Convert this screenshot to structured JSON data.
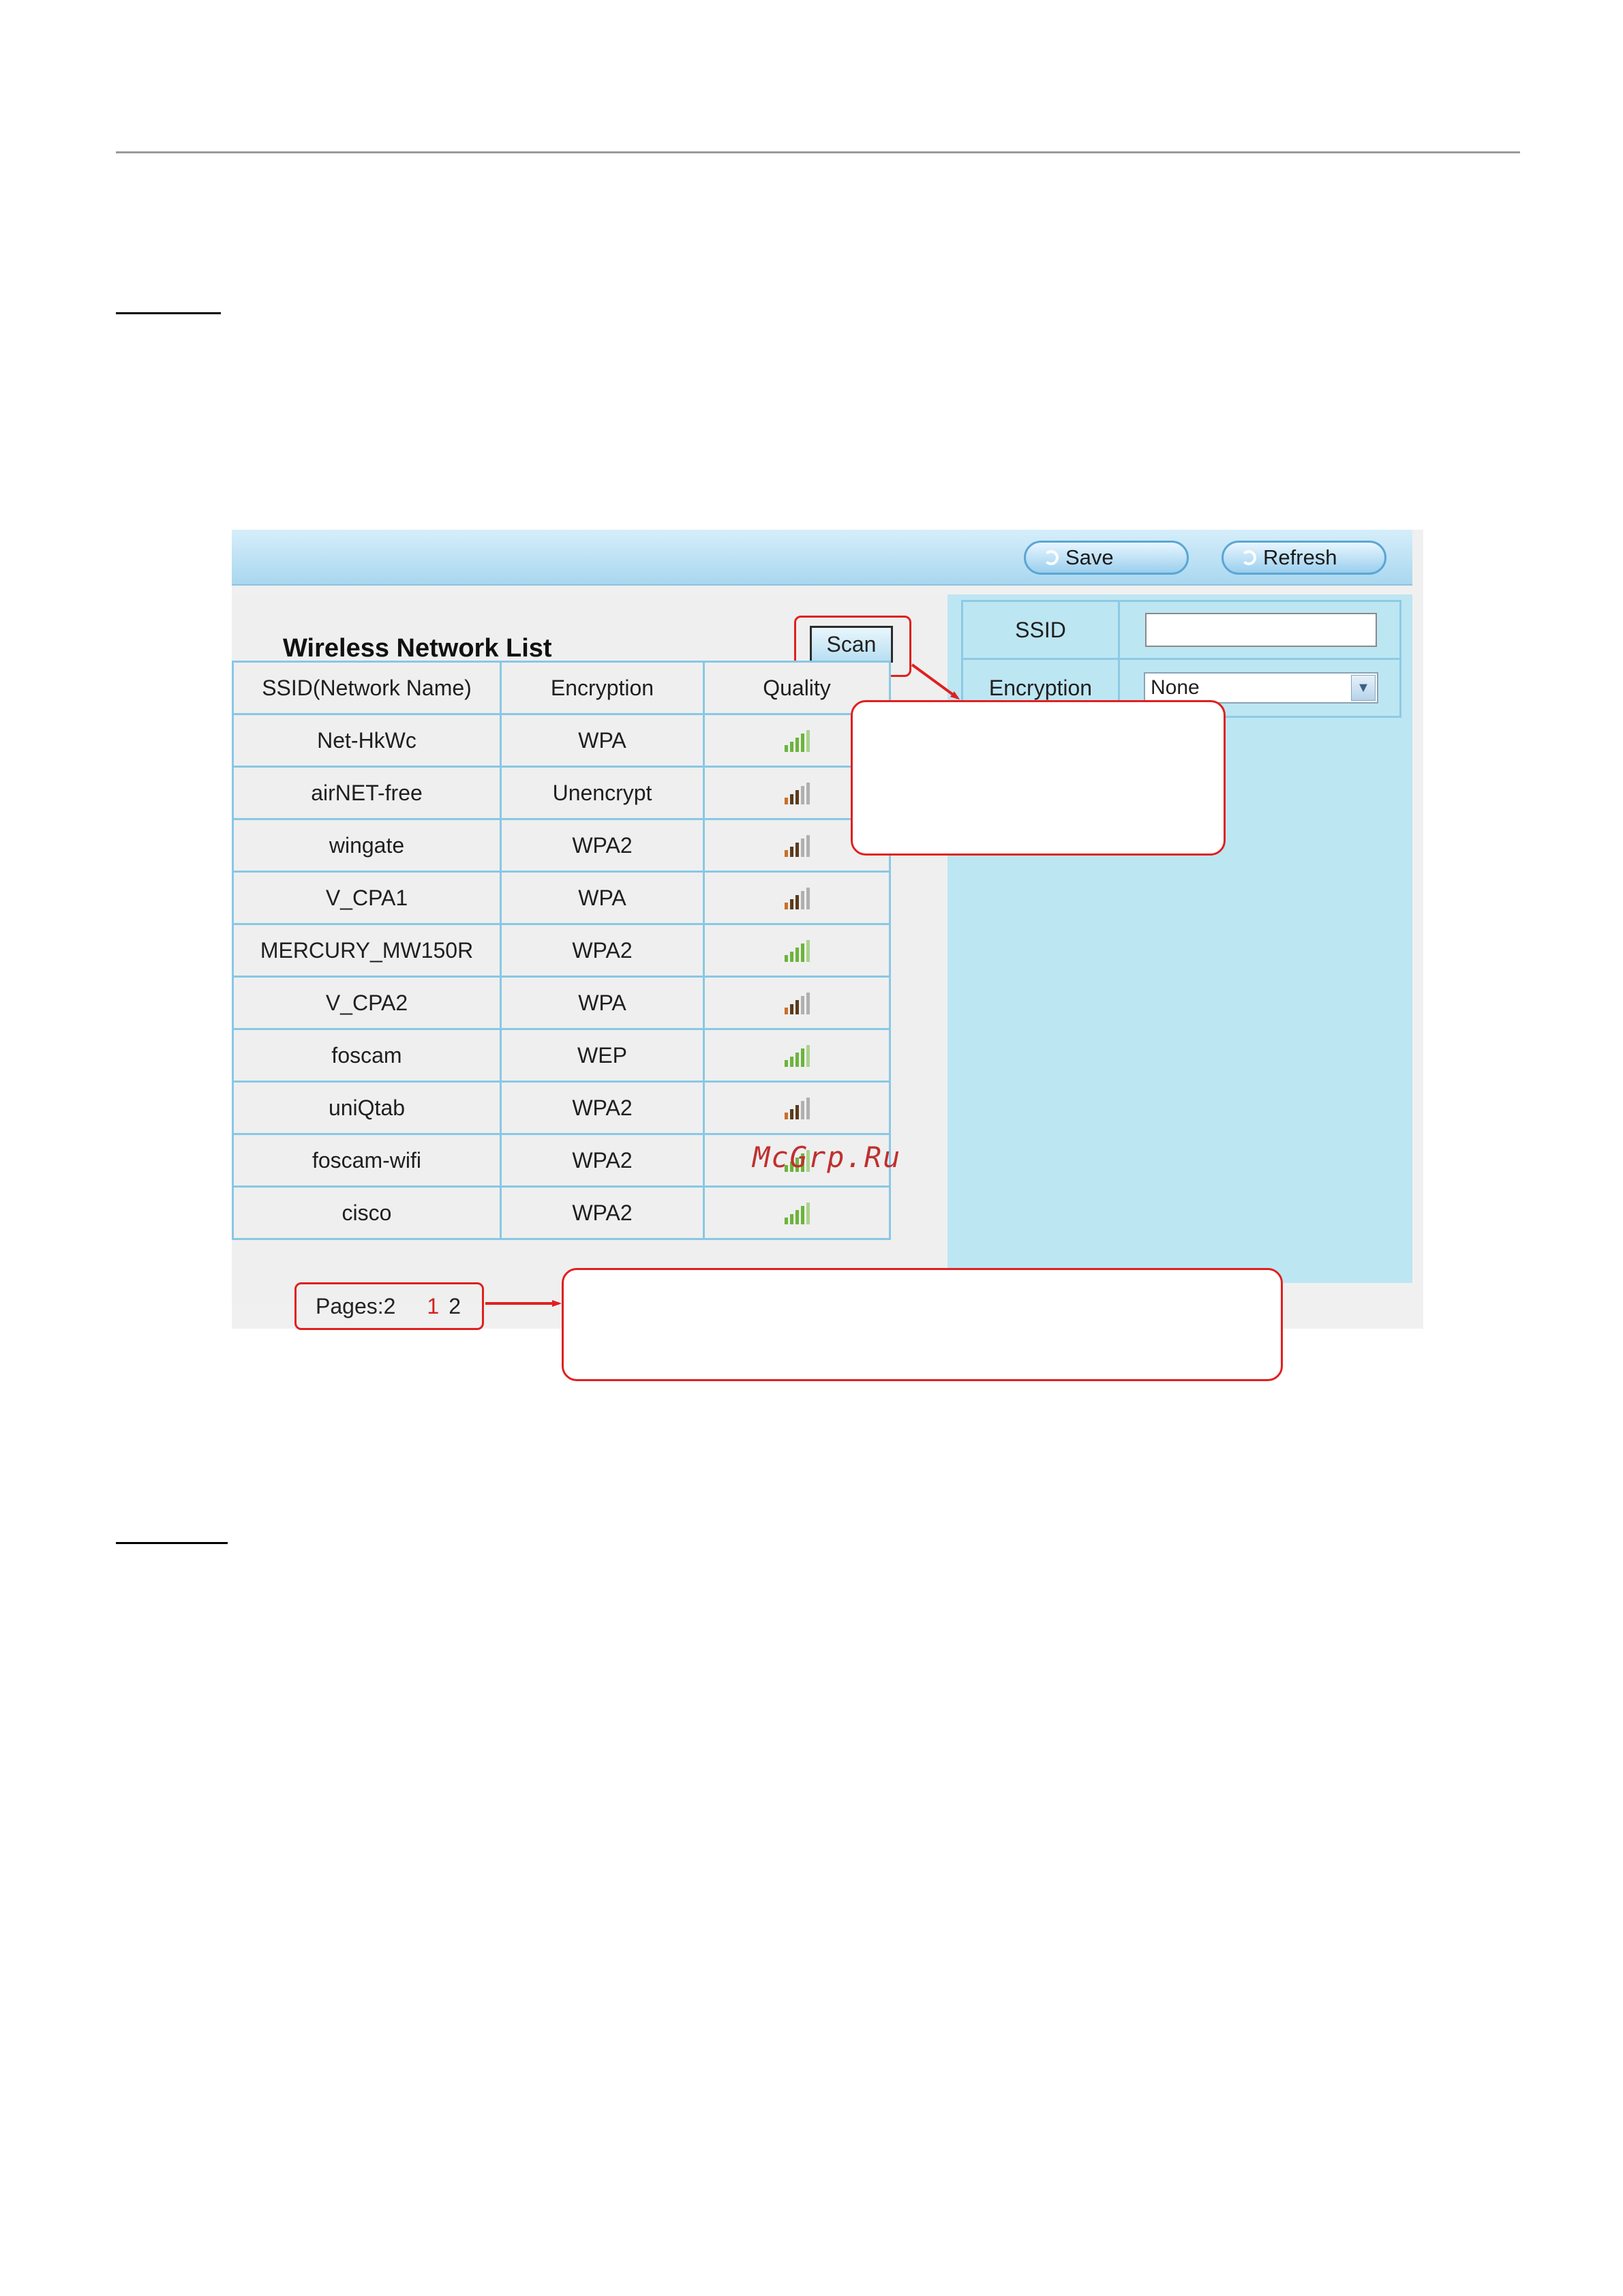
{
  "toolbar": {
    "save_label": "Save",
    "refresh_label": "Refresh"
  },
  "list": {
    "title": "Wireless Network List",
    "scan_label": "Scan",
    "columns": [
      "SSID(Network Name)",
      "Encryption",
      "Quality"
    ],
    "rows": [
      {
        "ssid": "Net-HkWc",
        "encryption": "WPA",
        "quality": 4
      },
      {
        "ssid": "airNET-free",
        "encryption": "Unencrypt",
        "quality": 3
      },
      {
        "ssid": "wingate",
        "encryption": "WPA2",
        "quality": 3
      },
      {
        "ssid": "V_CPA1",
        "encryption": "WPA",
        "quality": 3
      },
      {
        "ssid": "MERCURY_MW150R",
        "encryption": "WPA2",
        "quality": 4
      },
      {
        "ssid": "V_CPA2",
        "encryption": "WPA",
        "quality": 3
      },
      {
        "ssid": "foscam",
        "encryption": "WEP",
        "quality": 4
      },
      {
        "ssid": "uniQtab",
        "encryption": "WPA2",
        "quality": 3
      },
      {
        "ssid": "foscam-wifi",
        "encryption": "WPA2",
        "quality": 4
      },
      {
        "ssid": "cisco",
        "encryption": "WPA2",
        "quality": 4
      }
    ],
    "pages_label": "Pages:2",
    "page_current": "1",
    "page_next": "2"
  },
  "settings": {
    "ssid_label": "SSID",
    "ssid_value": "",
    "encryption_label": "Encryption",
    "encryption_value": "None"
  },
  "watermark": "McGrp.Ru",
  "colors": {
    "strong_signal": "#6cb43c",
    "weak_signal": "#5a3b1c",
    "callout_red": "#e0201f",
    "panel_blue": "#bde6f3"
  }
}
